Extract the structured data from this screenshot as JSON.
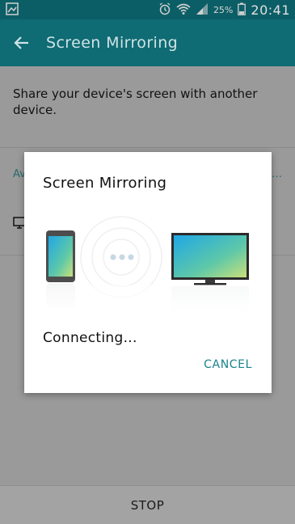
{
  "status_bar": {
    "battery_percent": "25%",
    "time": "20:41",
    "icons": [
      "gallery-notification-icon",
      "alarm-icon",
      "wifi-icon",
      "signal-icon",
      "battery-icon"
    ]
  },
  "app_bar": {
    "title": "Screen Mirroring",
    "back_icon": "arrow-left-icon",
    "background_color": "#0f6b74"
  },
  "main": {
    "description": "Share your device's screen with another device.",
    "available_label": "Av",
    "available_more": "…",
    "device_icon": "tv-icon"
  },
  "bottom_bar": {
    "stop_label": "STOP"
  },
  "dialog": {
    "title": "Screen Mirroring",
    "status": "Connecting...",
    "cancel_label": "CANCEL",
    "accent_color": "#19848c",
    "illustration": [
      "phone-icon",
      "connecting-dots-icon",
      "tv-icon"
    ]
  }
}
